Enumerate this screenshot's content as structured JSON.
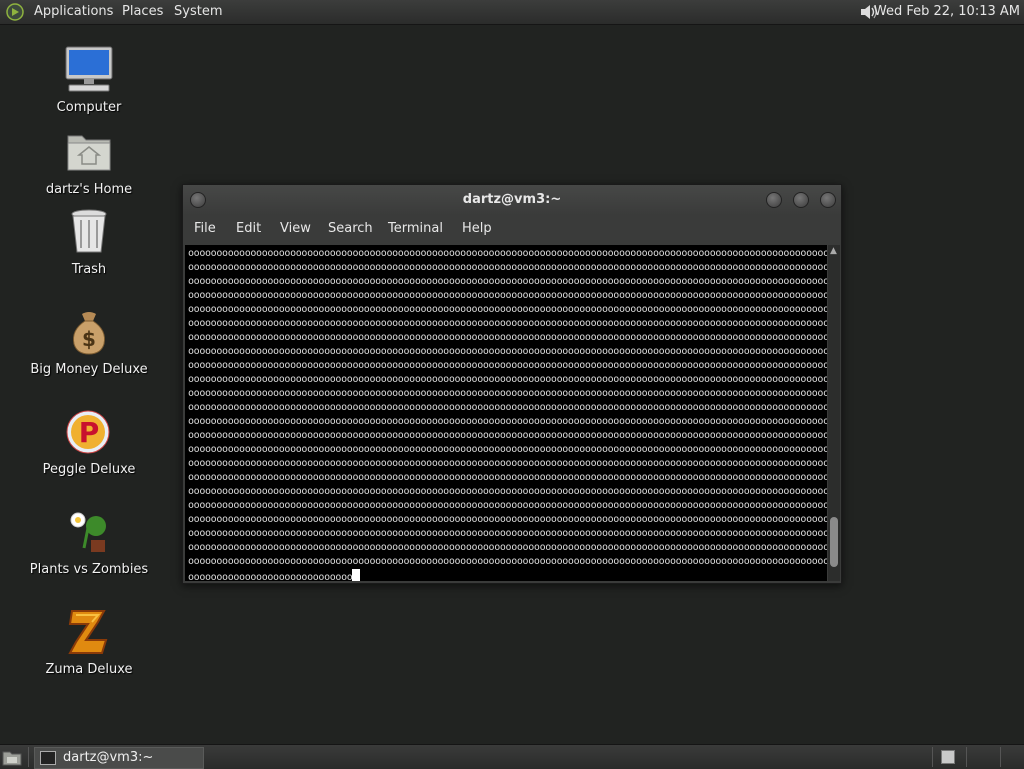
{
  "top_panel": {
    "menus": [
      "Applications",
      "Places",
      "System"
    ],
    "clock": "Wed Feb 22, 10:13 AM",
    "icons": {
      "logo": "gnome-foot-icon",
      "volume": "speaker-icon"
    }
  },
  "desktop": {
    "icons": [
      {
        "label": "Computer",
        "icon": "computer-icon"
      },
      {
        "label": "dartz's Home",
        "icon": "home-folder-icon"
      },
      {
        "label": "Trash",
        "icon": "trash-icon"
      },
      {
        "label": "Big Money Deluxe",
        "icon": "money-bag-icon"
      },
      {
        "label": "Peggle Deluxe",
        "icon": "peggle-icon"
      },
      {
        "label": "Plants vs Zombies",
        "icon": "plants-icon"
      },
      {
        "label": "Zuma Deluxe",
        "icon": "zuma-icon"
      }
    ]
  },
  "terminal": {
    "title": "dartz@vm3:~",
    "menu": [
      "File",
      "Edit",
      "View",
      "Search",
      "Terminal",
      "Help"
    ],
    "full_line": "oooooooooooooooooooooooooooooooooooooooooooooooooooooooooooooooooooooooooooooooooooooooooooooooooooooooooooooooooooooo",
    "full_line_count": 23,
    "last_line": "ooooooooooooooooooooooooooooo"
  },
  "bottom_panel": {
    "task_label": "dartz@vm3:~"
  },
  "colors": {
    "desktop_bg": "#212321",
    "panel_bg": "#353635",
    "terminal_bg": "#000000"
  }
}
